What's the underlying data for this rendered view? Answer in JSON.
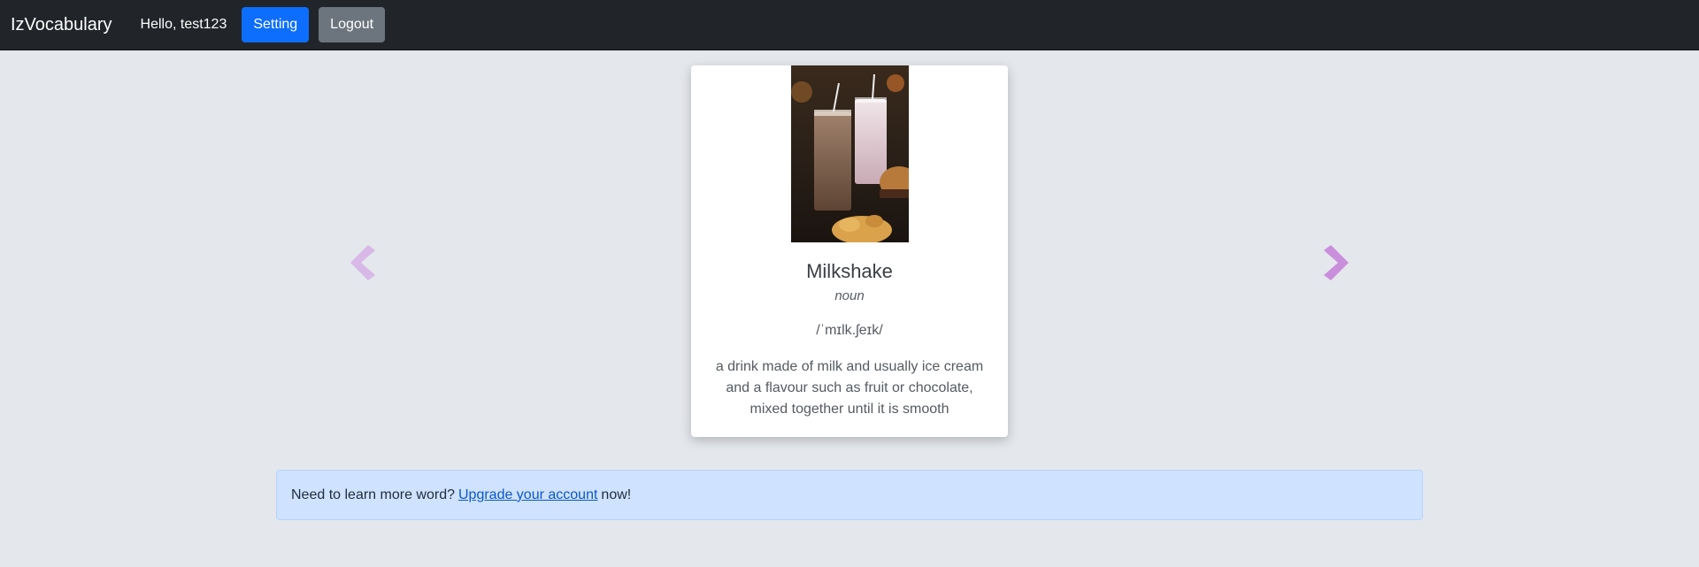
{
  "navbar": {
    "brand": "IzVocabulary",
    "greeting": "Hello, test123",
    "setting_label": "Setting",
    "logout_label": "Logout"
  },
  "card": {
    "word": "Milkshake",
    "part_of_speech": "noun",
    "pronunciation": "/ˈmɪlk.ʃeɪk/",
    "definition": "a drink made of milk and usually ice cream and a flavour such as fruit or chocolate, mixed together until it is smooth"
  },
  "navigation": {
    "prev_icon": "chevron-left-icon",
    "next_icon": "chevron-right-icon"
  },
  "alert": {
    "prefix": "Need to learn more word?",
    "link_text": "Upgrade your account",
    "suffix": "now!"
  },
  "colors": {
    "navbar_bg": "#212529",
    "primary": "#0d6efd",
    "secondary": "#6c757d",
    "page_bg": "#e4e7ec",
    "alert_bg": "#cfe2ff",
    "arrow_left": "#d8b8e6",
    "arrow_right": "#c98fdc"
  }
}
